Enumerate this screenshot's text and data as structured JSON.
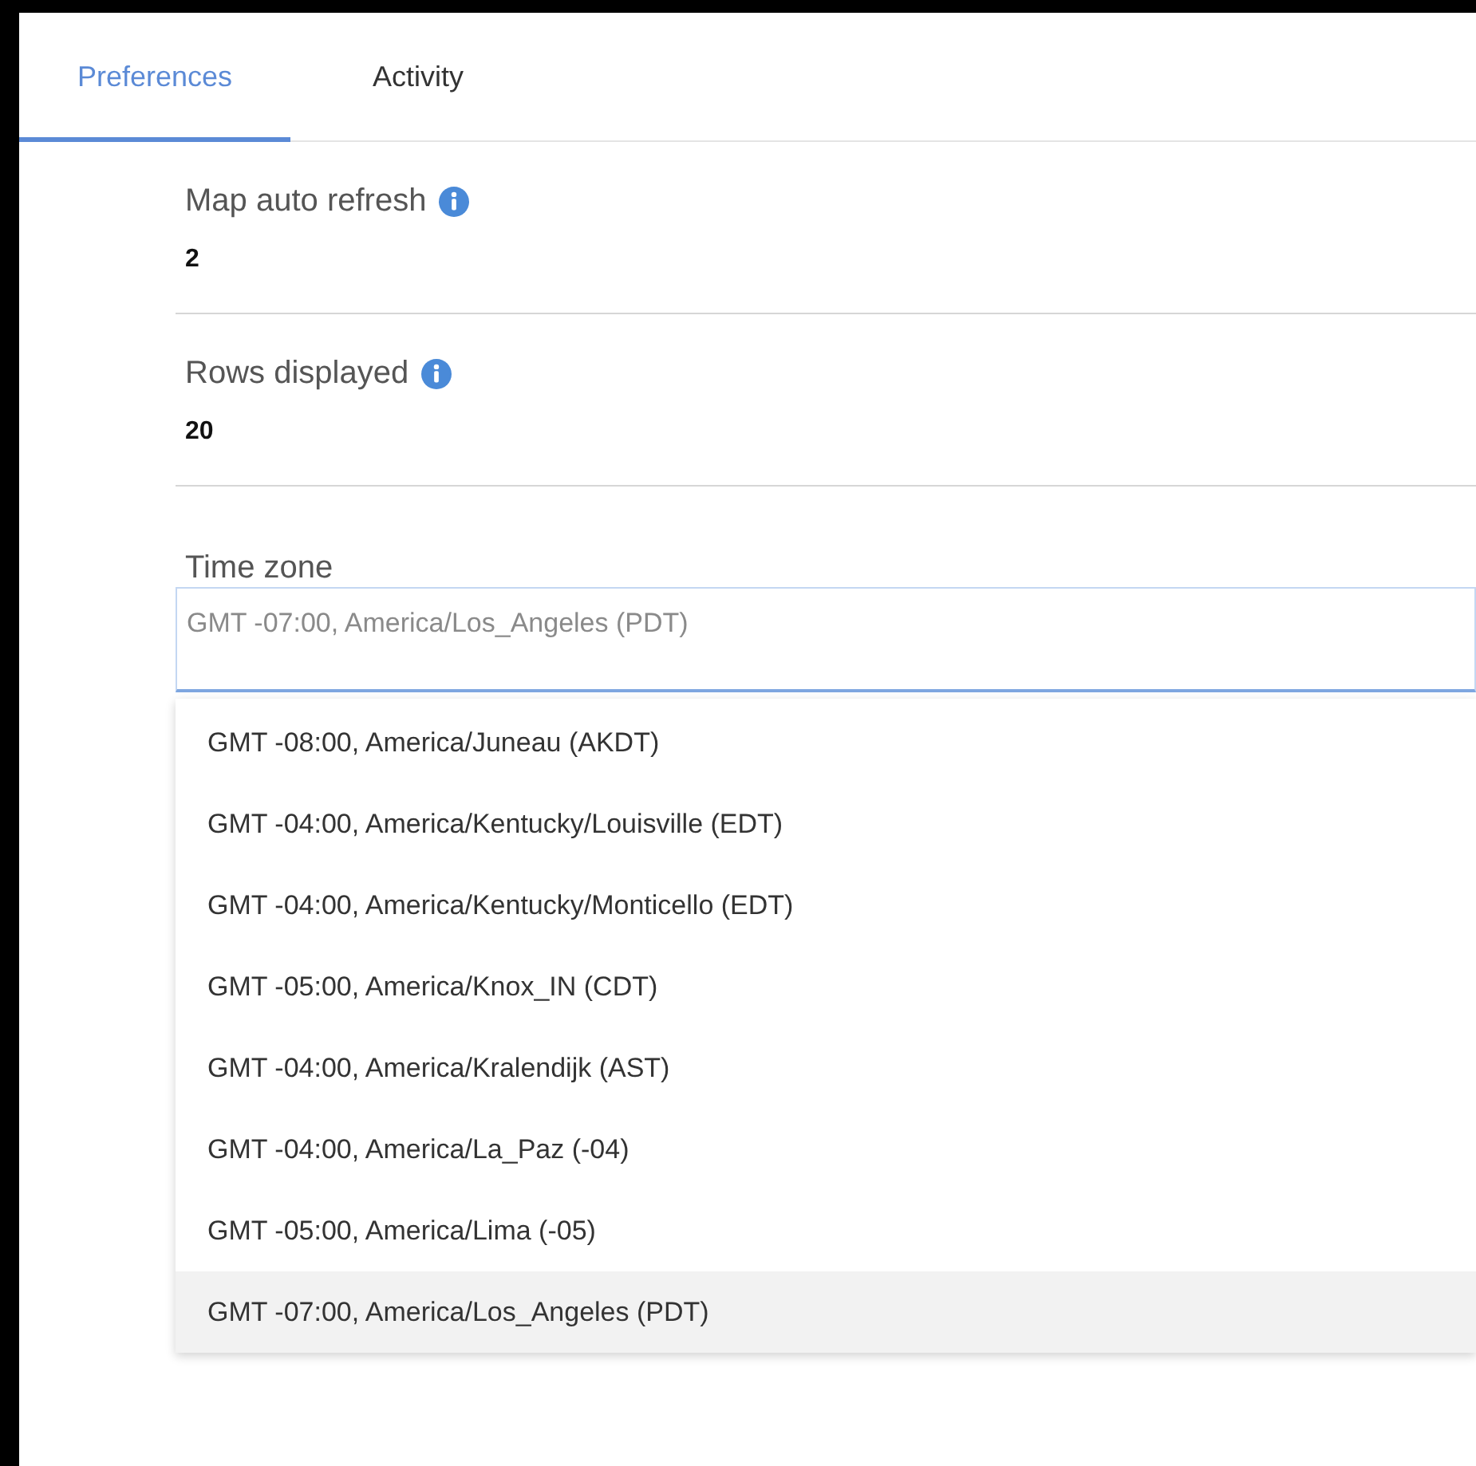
{
  "tabs": [
    {
      "label": "Preferences",
      "selected": true
    },
    {
      "label": "Activity",
      "selected": false
    }
  ],
  "settings": [
    {
      "label": "Map auto refresh",
      "value": "2"
    },
    {
      "label": "Rows displayed",
      "value": "20"
    }
  ],
  "time_zone": {
    "label": "Time zone",
    "placeholder": "GMT -07:00, America/Los_Angeles (PDT)",
    "options": [
      {
        "label": "GMT -08:00, America/Juneau (AKDT)",
        "selected": false
      },
      {
        "label": "GMT -04:00, America/Kentucky/Louisville (EDT)",
        "selected": false
      },
      {
        "label": "GMT -04:00, America/Kentucky/Monticello (EDT)",
        "selected": false
      },
      {
        "label": "GMT -05:00, America/Knox_IN (CDT)",
        "selected": false
      },
      {
        "label": "GMT -04:00, America/Kralendijk (AST)",
        "selected": false
      },
      {
        "label": "GMT -04:00, America/La_Paz (-04)",
        "selected": false
      },
      {
        "label": "GMT -05:00, America/Lima (-05)",
        "selected": false
      },
      {
        "label": "GMT -07:00, America/Los_Angeles (PDT)",
        "selected": true
      }
    ]
  }
}
